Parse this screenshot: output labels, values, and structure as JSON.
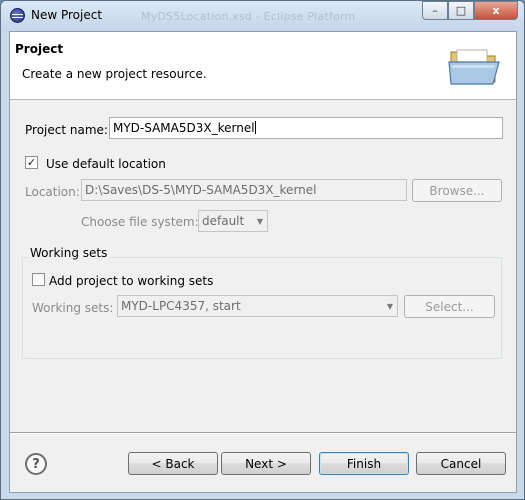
{
  "window": {
    "title": "New Project",
    "background_title": "MyDS5Location.xsd - Eclipse Platform",
    "minimize_glyph": "–",
    "maximize_glyph": "□",
    "close_glyph": "x"
  },
  "banner": {
    "heading": "Project",
    "description": "Create a new project resource.",
    "icon": "folder-icon"
  },
  "project_name": {
    "label": "Project name:",
    "value": "MYD-SAMA5D3X_kernel"
  },
  "default_location": {
    "label": "Use default location",
    "checked": true,
    "check_glyph": "✓"
  },
  "location": {
    "label": "Location:",
    "value": "D:\\Saves\\DS-5\\MYD-SAMA5D3X_kernel",
    "browse_label": "Browse..."
  },
  "file_system": {
    "label": "Choose file system:",
    "value": "default"
  },
  "working_sets": {
    "group_title": "Working sets",
    "add_label": "Add project to working sets",
    "add_checked": false,
    "sets_label": "Working sets:",
    "sets_value": "MYD-LPC4357, start",
    "select_label": "Select..."
  },
  "footer": {
    "help_glyph": "?",
    "back_label": "< Back",
    "next_label": "Next >",
    "finish_label": "Finish",
    "cancel_label": "Cancel"
  },
  "colors": {
    "window_frame": "#c9d9ea",
    "dialog_bg": "#f0f0f0",
    "close_button": "#c4543a",
    "primary_button_border": "#3c7fb1"
  }
}
